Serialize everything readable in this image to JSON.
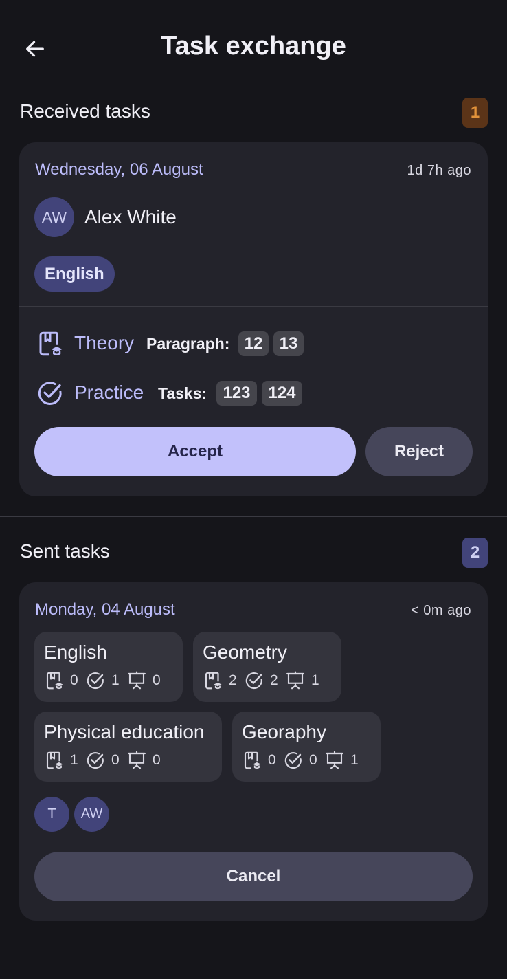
{
  "header": {
    "title": "Task exchange",
    "back_icon": "arrow-left-icon"
  },
  "received": {
    "title": "Received tasks",
    "count": "1",
    "count_color": "#e2923a",
    "card": {
      "date": "Wednesday, 06 August",
      "ago": "1d 7h ago",
      "sender": {
        "initials": "AW",
        "name": "Alex White"
      },
      "subject": "English",
      "theory": {
        "label": "Theory",
        "key": "Paragraph:",
        "items": [
          "12",
          "13"
        ]
      },
      "practice": {
        "label": "Practice",
        "key": "Tasks:",
        "items": [
          "123",
          "124"
        ]
      },
      "accept_label": "Accept",
      "reject_label": "Reject"
    }
  },
  "sent": {
    "title": "Sent tasks",
    "count": "2",
    "card": {
      "date": "Monday, 04 August",
      "ago": "< 0m ago",
      "subjects": [
        {
          "name": "English",
          "theory": "0",
          "practice": "1",
          "presentation": "0"
        },
        {
          "name": "Geometry",
          "theory": "2",
          "practice": "2",
          "presentation": "1"
        },
        {
          "name": "Physical education",
          "theory": "1",
          "practice": "0",
          "presentation": "0"
        },
        {
          "name": "Georaphy",
          "theory": "0",
          "practice": "0",
          "presentation": "1"
        }
      ],
      "recipients": [
        "T",
        "AW"
      ],
      "cancel_label": "Cancel"
    }
  },
  "colors": {
    "accent": "#bcbcfa",
    "background": "#15151a",
    "card": "#23232b",
    "chip": "#42447a"
  }
}
